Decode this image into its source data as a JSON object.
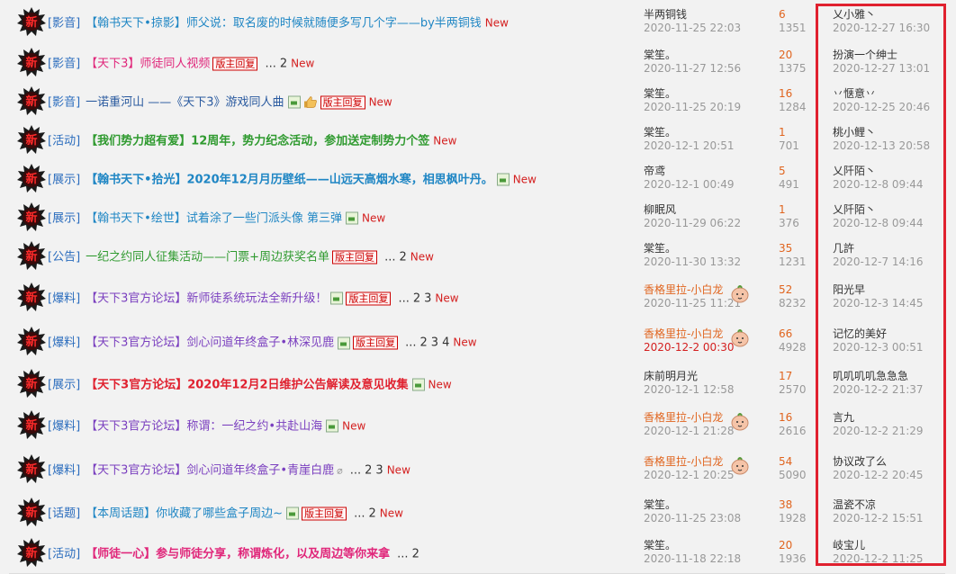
{
  "rows": [
    {
      "cat": "[影音]",
      "title": "【翰书天下•掠影】师父说：取名废的时候就随便多写几个字——by半两铜钱",
      "color": "c-blue",
      "bold": false,
      "img": false,
      "thumb": false,
      "clip": false,
      "reply": false,
      "pages": [],
      "new": "New",
      "author": "半两铜钱",
      "author_orange": false,
      "date": "2020-11-25 22:03",
      "date_red": false,
      "avatar": false,
      "replies": "6",
      "views": "1351",
      "last_user": "乂小雅丶",
      "last_time": "2020-12-27 16:30"
    },
    {
      "cat": "[影音]",
      "title": "【天下3】师徒同人视频",
      "color": "c-pink",
      "bold": false,
      "img": false,
      "thumb": false,
      "clip": false,
      "reply": true,
      "pages": [
        "...",
        "2"
      ],
      "new": "New",
      "author": "棠笙。",
      "author_orange": false,
      "date": "2020-11-27 12:56",
      "date_red": false,
      "avatar": false,
      "replies": "20",
      "views": "1375",
      "last_user": "扮演一个绅士",
      "last_time": "2020-12-27 13:01"
    },
    {
      "cat": "[影音]",
      "title": "一诺重河山 ——《天下3》游戏同人曲",
      "color": "c-dblue",
      "bold": false,
      "img": true,
      "thumb": true,
      "clip": false,
      "reply": true,
      "pages": [],
      "new": "New",
      "author": "棠笙。",
      "author_orange": false,
      "date": "2020-11-25 20:19",
      "date_red": false,
      "avatar": false,
      "replies": "16",
      "views": "1284",
      "last_user": "丷惬意丷",
      "last_time": "2020-12-25 20:46"
    },
    {
      "cat": "[活动]",
      "title": "【我们势力超有爱】12周年，势力纪念活动，参加送定制势力个签",
      "color": "c-green",
      "bold": true,
      "img": false,
      "thumb": false,
      "clip": false,
      "reply": false,
      "pages": [],
      "new": "New",
      "author": "棠笙。",
      "author_orange": false,
      "date": "2020-12-1 20:51",
      "date_red": false,
      "avatar": false,
      "replies": "1",
      "views": "701",
      "last_user": "桃小鲤丶",
      "last_time": "2020-12-13 20:58"
    },
    {
      "cat": "[展示]",
      "title": "【翰书天下•拾光】2020年12月月历壁纸——山远天高烟水寒，相思枫叶丹。",
      "color": "c-blue",
      "bold": true,
      "img": true,
      "thumb": false,
      "clip": false,
      "reply": false,
      "pages": [],
      "new": "New",
      "author": "帝鸢",
      "author_orange": false,
      "date": "2020-12-1 00:49",
      "date_red": false,
      "avatar": false,
      "replies": "5",
      "views": "491",
      "last_user": "乂阡陌丶",
      "last_time": "2020-12-8 09:44"
    },
    {
      "cat": "[展示]",
      "title": "【翰书天下•绘世】试着涂了一些门派头像 第三弹",
      "color": "c-blue",
      "bold": false,
      "img": true,
      "thumb": false,
      "clip": false,
      "reply": false,
      "pages": [],
      "new": "New",
      "author": "柳眠风",
      "author_orange": false,
      "date": "2020-11-29 06:22",
      "date_red": false,
      "avatar": false,
      "replies": "1",
      "views": "376",
      "last_user": "乂阡陌丶",
      "last_time": "2020-12-8 09:44"
    },
    {
      "cat": "[公告]",
      "title": "一纪之约同人征集活动——门票+周边获奖名单",
      "color": "c-green",
      "bold": false,
      "img": false,
      "thumb": false,
      "clip": false,
      "reply": true,
      "pages": [
        "...",
        "2"
      ],
      "new": "New",
      "author": "棠笙。",
      "author_orange": false,
      "date": "2020-11-30 13:32",
      "date_red": false,
      "avatar": false,
      "replies": "35",
      "views": "1231",
      "last_user": "几許",
      "last_time": "2020-12-7 14:16"
    },
    {
      "cat": "[爆料]",
      "title": "【天下3官方论坛】新师徒系统玩法全新升级！",
      "color": "c-purple",
      "bold": false,
      "img": true,
      "thumb": false,
      "clip": false,
      "reply": true,
      "pages": [
        "...",
        "2",
        "3"
      ],
      "new": "New",
      "author": "香格里拉-小白龙",
      "author_orange": true,
      "date": "2020-11-25 11:21",
      "date_red": false,
      "avatar": true,
      "replies": "52",
      "views": "8232",
      "last_user": "阳光早",
      "last_time": "2020-12-3 14:45"
    },
    {
      "cat": "[爆料]",
      "title": "【天下3官方论坛】剑心问道年终盒子•林深见鹿",
      "color": "c-purple",
      "bold": false,
      "img": true,
      "thumb": false,
      "clip": false,
      "reply": true,
      "pages": [
        "...",
        "2",
        "3",
        "4"
      ],
      "new": "New",
      "author": "香格里拉-小白龙",
      "author_orange": true,
      "date": "2020-12-2 00:30",
      "date_red": true,
      "avatar": true,
      "replies": "66",
      "views": "4928",
      "last_user": "记忆的美好",
      "last_time": "2020-12-3 00:51"
    },
    {
      "cat": "[展示]",
      "title": "【天下3官方论坛】2020年12月2日维护公告解读及意见收集",
      "color": "c-red",
      "bold": true,
      "img": true,
      "thumb": false,
      "clip": false,
      "reply": false,
      "pages": [],
      "new": "New",
      "author": "床前明月光",
      "author_orange": false,
      "date": "2020-12-1 12:58",
      "date_red": false,
      "avatar": false,
      "replies": "17",
      "views": "2570",
      "last_user": "叽叽叽叽急急急",
      "last_time": "2020-12-2 21:37"
    },
    {
      "cat": "[爆料]",
      "title": "【天下3官方论坛】称谓：一纪之约•共赴山海",
      "color": "c-purple",
      "bold": false,
      "img": true,
      "thumb": false,
      "clip": false,
      "reply": false,
      "pages": [],
      "new": "New",
      "author": "香格里拉-小白龙",
      "author_orange": true,
      "date": "2020-12-1 21:28",
      "date_red": false,
      "avatar": true,
      "replies": "16",
      "views": "2616",
      "last_user": "言九",
      "last_time": "2020-12-2 21:29"
    },
    {
      "cat": "[爆料]",
      "title": "【天下3官方论坛】剑心问道年终盒子•青崖白鹿",
      "color": "c-purple",
      "bold": false,
      "img": false,
      "thumb": false,
      "clip": true,
      "reply": false,
      "pages": [
        "...",
        "2",
        "3"
      ],
      "new": "New",
      "author": "香格里拉-小白龙",
      "author_orange": true,
      "date": "2020-12-1 20:25",
      "date_red": false,
      "avatar": true,
      "replies": "54",
      "views": "5090",
      "last_user": "协议改了么",
      "last_time": "2020-12-2 20:45"
    },
    {
      "cat": "[话题]",
      "title": "【本周话题】你收藏了哪些盒子周边~",
      "color": "c-blue",
      "bold": false,
      "img": true,
      "thumb": false,
      "clip": false,
      "reply": true,
      "pages": [
        "...",
        "2"
      ],
      "new": "New",
      "author": "棠笙。",
      "author_orange": false,
      "date": "2020-11-25 23:08",
      "date_red": false,
      "avatar": false,
      "replies": "38",
      "views": "1928",
      "last_user": "温瓷不凉",
      "last_time": "2020-12-2 15:51"
    },
    {
      "cat": "[活动]",
      "title": "【师徒一心】参与师徒分享，称谓炼化，以及周边等你来拿",
      "color": "c-pink",
      "bold": true,
      "img": false,
      "thumb": false,
      "clip": false,
      "reply": false,
      "pages": [
        "...",
        "2"
      ],
      "new": "",
      "author": "棠笙。",
      "author_orange": false,
      "date": "2020-11-18 22:18",
      "date_red": false,
      "avatar": false,
      "replies": "20",
      "views": "1936",
      "last_user": "岐宝儿",
      "last_time": "2020-12-2 11:25"
    }
  ],
  "labels": {
    "reply_badge": "版主回复"
  }
}
